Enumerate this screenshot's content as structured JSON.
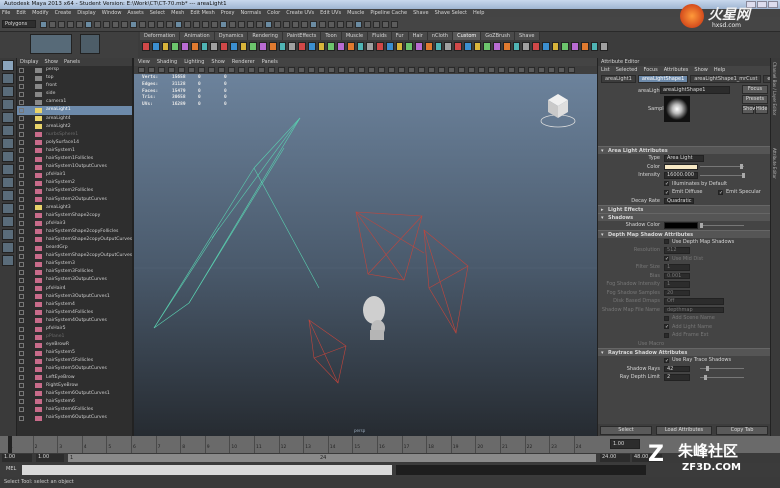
{
  "window": {
    "title": "Autodesk Maya 2013 x64 - Student Version: E:\\Work\\CT\\CT-70.mb* --- areaLight1"
  },
  "menubar": [
    "File",
    "Edit",
    "Modify",
    "Create",
    "Display",
    "Window",
    "Assets",
    "Select",
    "Mesh",
    "Edit Mesh",
    "Proxy",
    "Normals",
    "Color",
    "Create UVs",
    "Edit UVs",
    "Muscle",
    "Pipeline Cache",
    "Shave",
    "Shave Select",
    "Help"
  ],
  "status": {
    "mode": "Polygons"
  },
  "shelf": {
    "tabs": [
      "Deformation",
      "Animation",
      "Dynamics",
      "Rendering",
      "PaintEffects",
      "Toon",
      "Muscle",
      "Fluids",
      "Fur",
      "Hair",
      "nCloth",
      "Custom",
      "GoZBrush",
      "Shave"
    ],
    "active_tab": "Custom",
    "icon_labels": [
      "FR",
      "Cloth",
      "Mv",
      "Root",
      "Beg",
      "DTS",
      "Imp",
      "Copy",
      "Out",
      "UVI",
      "UDE",
      "T.Inv"
    ]
  },
  "logo": {
    "text": "火星网",
    "url": "hxsd.com"
  },
  "watermark": {
    "text": "朱峰社区",
    "url": "ZF3D.COM"
  },
  "outliner": {
    "menu": [
      "Display",
      "Show",
      "Panels"
    ],
    "items": [
      {
        "label": "persp",
        "kind": "cam"
      },
      {
        "label": "top",
        "kind": "cam"
      },
      {
        "label": "front",
        "kind": "cam"
      },
      {
        "label": "side",
        "kind": "cam"
      },
      {
        "label": "camera1",
        "kind": "cam"
      },
      {
        "label": "areaLight1",
        "kind": "light",
        "selected": true
      },
      {
        "label": "areaLight4",
        "kind": "light"
      },
      {
        "label": "areaLight2",
        "kind": "light"
      },
      {
        "label": "nurbsSphere1",
        "kind": "dim"
      },
      {
        "label": "polySurface14",
        "kind": "mesh"
      },
      {
        "label": "hairSystem1",
        "kind": "mesh"
      },
      {
        "label": "hairSystem1Follicles",
        "kind": "mesh"
      },
      {
        "label": "hairSystem1OutputCurves",
        "kind": "mesh"
      },
      {
        "label": "pfxHair1",
        "kind": "mesh"
      },
      {
        "label": "hairSystem2",
        "kind": "mesh"
      },
      {
        "label": "hairSystem2Follicles",
        "kind": "mesh"
      },
      {
        "label": "hairSystem2OutputCurves",
        "kind": "mesh"
      },
      {
        "label": "areaLight3",
        "kind": "light"
      },
      {
        "label": "hairSystemShape2copy",
        "kind": "mesh"
      },
      {
        "label": "pfxHair3",
        "kind": "mesh"
      },
      {
        "label": "hairSystemShape2copyFollicles",
        "kind": "mesh"
      },
      {
        "label": "hairSystemShape2copyOutputCurves",
        "kind": "mesh"
      },
      {
        "label": "beardGrp",
        "kind": "mesh"
      },
      {
        "label": "hairSystemShape2copyOutputCurves1",
        "kind": "mesh"
      },
      {
        "label": "hairSystem3",
        "kind": "mesh"
      },
      {
        "label": "hairSystem3Follicles",
        "kind": "mesh"
      },
      {
        "label": "hairSystem3OutputCurves",
        "kind": "mesh"
      },
      {
        "label": "pfxHair4",
        "kind": "mesh"
      },
      {
        "label": "hairSystem3OutputCurves1",
        "kind": "mesh"
      },
      {
        "label": "hairSystem4",
        "kind": "mesh"
      },
      {
        "label": "hairSystem4Follicles",
        "kind": "mesh"
      },
      {
        "label": "hairSystem4OutputCurves",
        "kind": "mesh"
      },
      {
        "label": "pfxHair5",
        "kind": "mesh"
      },
      {
        "label": "pPlane1",
        "kind": "dim"
      },
      {
        "label": "eyeBrowR",
        "kind": "mesh"
      },
      {
        "label": "hairSystem5",
        "kind": "mesh"
      },
      {
        "label": "hairSystem5Follicles",
        "kind": "mesh"
      },
      {
        "label": "hairSystem5OutputCurves",
        "kind": "mesh"
      },
      {
        "label": "LeftEyeBrow",
        "kind": "mesh"
      },
      {
        "label": "RightEyeBrow",
        "kind": "mesh"
      },
      {
        "label": "hairSystem6OutputCurves1",
        "kind": "mesh"
      },
      {
        "label": "hairSystem6",
        "kind": "mesh"
      },
      {
        "label": "hairSystem6Follicles",
        "kind": "mesh"
      },
      {
        "label": "hairSystem6OutputCurves",
        "kind": "mesh"
      }
    ]
  },
  "viewport": {
    "menu": [
      "View",
      "Shading",
      "Lighting",
      "Show",
      "Renderer",
      "Panels"
    ],
    "hud": [
      {
        "name": "Verts:",
        "a": "15658",
        "b": "0",
        "c": "0"
      },
      {
        "name": "Edges:",
        "a": "31128",
        "b": "0",
        "c": "0"
      },
      {
        "name": "Faces:",
        "a": "15479",
        "b": "0",
        "c": "0"
      },
      {
        "name": "Tris:",
        "a": "30658",
        "b": "0",
        "c": "0"
      },
      {
        "name": "UVs:",
        "a": "16289",
        "b": "0",
        "c": "0"
      }
    ],
    "camera": "persp"
  },
  "attribute_editor": {
    "title": "Attribute Editor",
    "menu": [
      "List",
      "Selected",
      "Focus",
      "Attributes",
      "Show",
      "Help"
    ],
    "tabs": [
      "areaLight1",
      "areaLightShape1",
      "areaLightShape1_mrCust",
      "eris",
      "pPlane1"
    ],
    "active_tab": "areaLightShape1",
    "node_label": "areaLight:",
    "node_value": "areaLightShape1",
    "buttons": [
      "Focus",
      "Presets",
      "Show",
      "Hide"
    ],
    "sample_label": "Sample",
    "sections": {
      "area": "Area Light Attributes",
      "effects": "Light Effects",
      "shadows": "Shadows",
      "depth": "Depth Map Shadow Attributes",
      "raytrace": "Raytrace Shadow Attributes"
    },
    "fields": {
      "type_label": "Type",
      "type_value": "Area Light",
      "color_label": "Color",
      "intensity_label": "Intensity",
      "intensity_value": "16000.000",
      "illum_default": "Illuminates by Default",
      "emit_diffuse": "Emit Diffuse",
      "emit_specular": "Emit Specular",
      "decay_label": "Decay Rate",
      "decay_value": "Quadratic",
      "shadow_color": "Shadow Color",
      "use_dm": "Use Depth Map Shadows",
      "resolution": "Resolution",
      "resolution_value": "512",
      "use_mid": "Use Mid Dist",
      "filter_size": "Filter Size",
      "filter_value": "1",
      "bias": "Bias",
      "bias_value": "0.001",
      "fog_int": "Fog Shadow Intensity",
      "fog_int_value": "1",
      "fog_samp": "Fog Shadow Samples",
      "fog_samp_value": "20",
      "disk_label": "Disk Based Dmaps",
      "disk_value": "Off",
      "sm_name": "Shadow Map File Name",
      "sm_value": "depthmap",
      "add_scene": "Add Scene Name",
      "add_light": "Add Light Name",
      "add_frame": "Add Frame Ext",
      "use_macro": "Use Macro",
      "use_ray": "Use Ray Trace Shadows",
      "shadow_rays": "Shadow Rays",
      "shadow_rays_value": "42",
      "ray_depth": "Ray Depth Limit",
      "ray_depth_value": "2"
    },
    "bottom_buttons": [
      "Select",
      "Load Attributes",
      "Copy Tab"
    ]
  },
  "side_tabs": [
    "Channel Box / Layer Editor",
    "Attribute Editor"
  ],
  "timeline": {
    "ticks": [
      "1",
      "2",
      "3",
      "4",
      "5",
      "6",
      "7",
      "8",
      "9",
      "10",
      "11",
      "12",
      "13",
      "14",
      "15",
      "16",
      "17",
      "18",
      "19",
      "20",
      "21",
      "22",
      "23",
      "24"
    ],
    "current_frame": "1.00"
  },
  "range": {
    "start": "1.00",
    "inner_start": "1.00",
    "cur": "1",
    "end_mark": "24",
    "inner_end": "24.00",
    "end": "48.00"
  },
  "cmdline": {
    "label": "MEL"
  },
  "help": {
    "text": "Select Tool: select an object"
  }
}
